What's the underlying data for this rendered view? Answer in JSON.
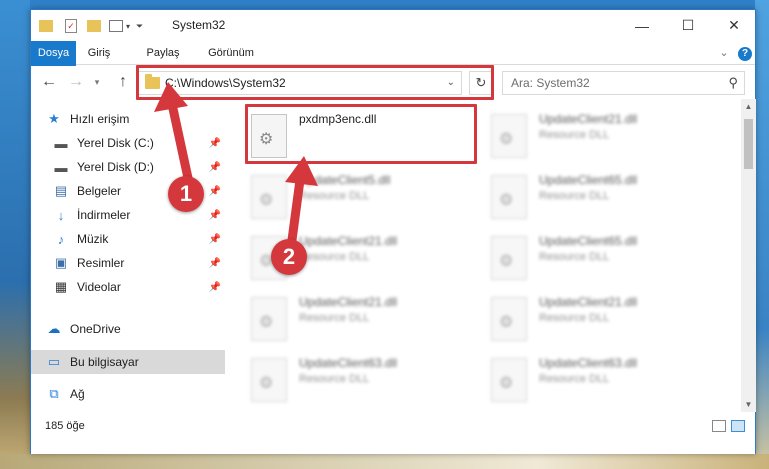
{
  "window": {
    "title": "System32",
    "minimize": "—",
    "maximize": "☐",
    "close": "✕"
  },
  "ribbon": {
    "tabs": [
      "Dosya",
      "Giriş",
      "Paylaş",
      "Görünüm"
    ],
    "collapse_icon": "⌄",
    "help_icon": "?"
  },
  "address": {
    "path": "C:\\Windows\\System32",
    "search_placeholder": "Ara: System32"
  },
  "nav": {
    "quick_access": "Hızlı erişim",
    "items": [
      {
        "label": "Yerel Disk (C:)",
        "icon": "drive-icon"
      },
      {
        "label": "Yerel Disk (D:)",
        "icon": "drive-icon"
      },
      {
        "label": "Belgeler",
        "icon": "documents-icon"
      },
      {
        "label": "İndirmeler",
        "icon": "downloads-icon"
      },
      {
        "label": "Müzik",
        "icon": "music-icon"
      },
      {
        "label": "Resimler",
        "icon": "pictures-icon"
      },
      {
        "label": "Videolar",
        "icon": "videos-icon"
      }
    ],
    "onedrive": "OneDrive",
    "this_pc": "Bu bilgisayar",
    "network": "Ağ"
  },
  "files": [
    {
      "name": "pxdmp3enc.dll",
      "type": ""
    },
    {
      "name": "UpdateClient21.dll",
      "type": "Resource DLL"
    },
    {
      "name": "UpdateClient5.dll",
      "type": "Resource DLL"
    },
    {
      "name": "UpdateClient65.dll",
      "type": "Resource DLL"
    },
    {
      "name": "UpdateClient21.dll",
      "type": "Resource DLL"
    },
    {
      "name": "UpdateClient65.dll",
      "type": "Resource DLL"
    },
    {
      "name": "UpdateClient21.dll",
      "type": "Resource DLL"
    },
    {
      "name": "UpdateClient21.dll",
      "type": "Resource DLL"
    },
    {
      "name": "UpdateClient63.dll",
      "type": "Resource DLL"
    },
    {
      "name": "UpdateClient63.dll",
      "type": "Resource DLL"
    }
  ],
  "status": {
    "count": "185 öğe"
  },
  "annotations": {
    "marker1": "1",
    "marker2": "2",
    "highlight_color": "#d4383d"
  }
}
